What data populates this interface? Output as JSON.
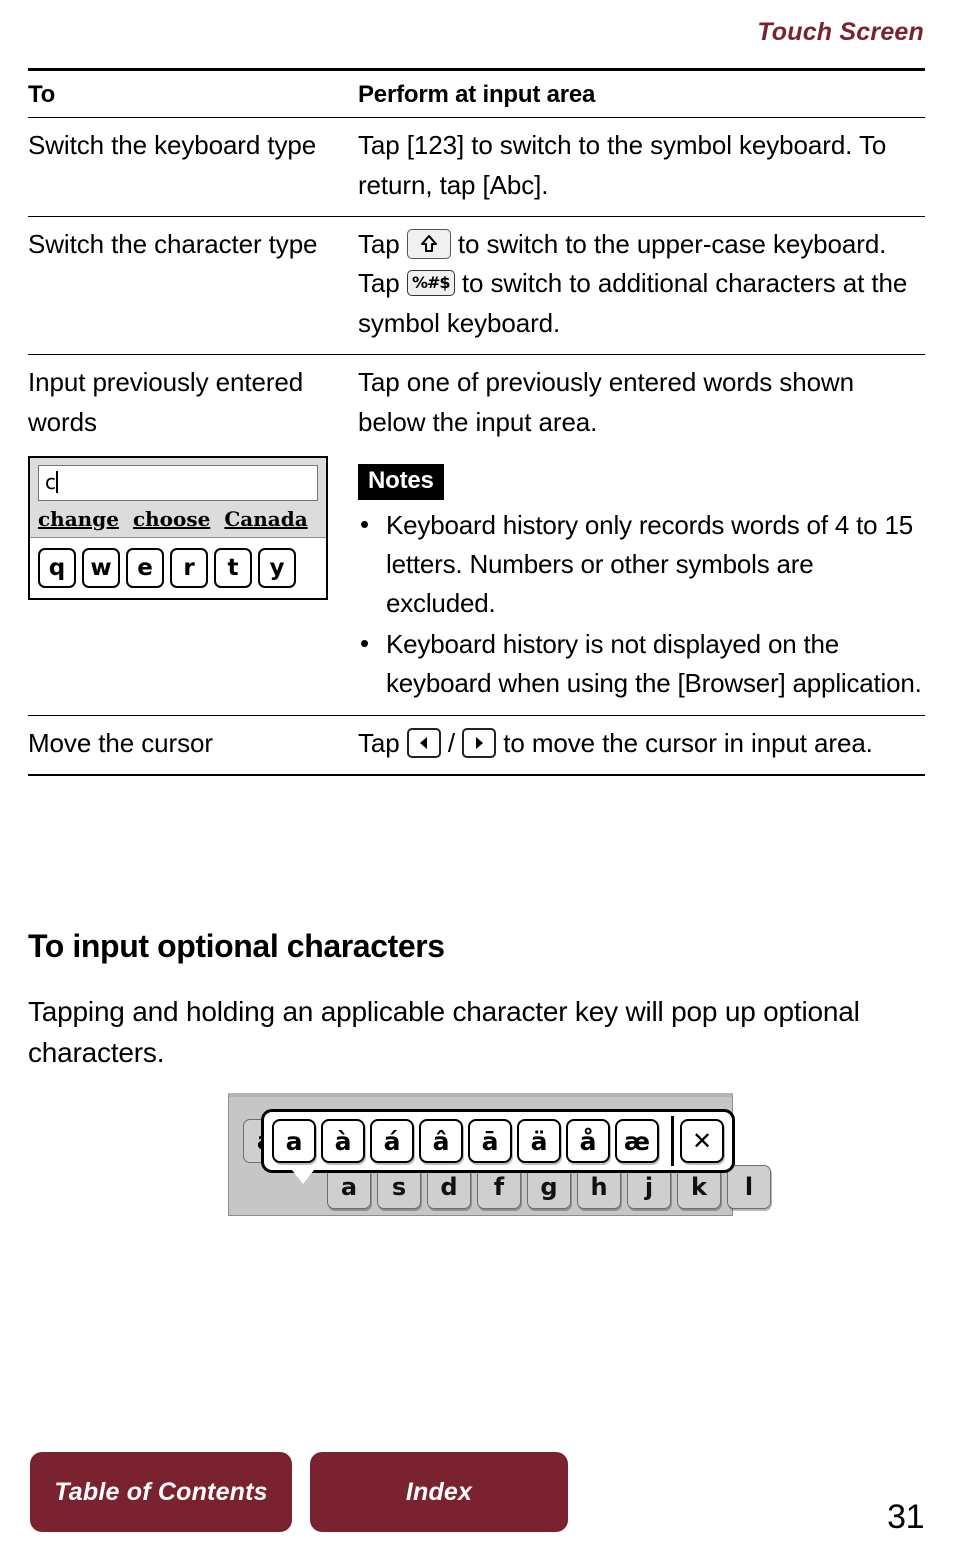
{
  "header": {
    "running_head": "Touch Screen"
  },
  "table": {
    "columns": [
      "To",
      "Perform at input area"
    ],
    "rows": [
      {
        "to": "Switch the keyboard type",
        "do_parts": [
          "Tap [123] to switch to the symbol keyboard. To return, tap [Abc]."
        ]
      },
      {
        "to": "Switch the character type",
        "do_pre": "Tap ",
        "do_mid": " to switch to the upper-case keyboard. Tap ",
        "sym_key_label": "%#$",
        "do_post": " to switch to additional characters at the symbol keyboard."
      },
      {
        "to": "Input previously entered words",
        "do": "Tap one of previously entered words shown below the input area."
      },
      {
        "to": "Move the cursor",
        "do_pre": "Tap ",
        "do_sep": " / ",
        "do_post": " to move the cursor in input area."
      }
    ]
  },
  "keyboard_figure": {
    "input_value": "c",
    "suggestions": [
      "change",
      "choose",
      "Canada"
    ],
    "keys": [
      "q",
      "w",
      "e",
      "r",
      "t",
      "y"
    ]
  },
  "notes": {
    "title": "Notes",
    "items": [
      "Keyboard history only records words of 4 to 15 letters. Numbers or other symbols are excluded.",
      "Keyboard history is not displayed on the keyboard when using the [Browser] application."
    ]
  },
  "section": {
    "heading": "To input optional characters",
    "paragraph": "Tapping and holding an applicable character key will pop up optional characters."
  },
  "popup_figure": {
    "optional_chars": [
      "a",
      "à",
      "á",
      "â",
      "ā",
      "ä",
      "å",
      "æ"
    ],
    "close_label": "✕",
    "home_row_keys": [
      "a",
      "s",
      "d",
      "f",
      "g",
      "h",
      "j",
      "k",
      "l"
    ],
    "hidden_key": "a"
  },
  "footer": {
    "toc_label": "Table of Contents",
    "index_label": "Index",
    "page_number": "31"
  },
  "colors": {
    "accent": "#7b2230",
    "text": "#000000",
    "figure_gray": "#c6c6c6",
    "key_gray": "#cfcfcf",
    "suggest_bar": "#dcdcdc"
  }
}
